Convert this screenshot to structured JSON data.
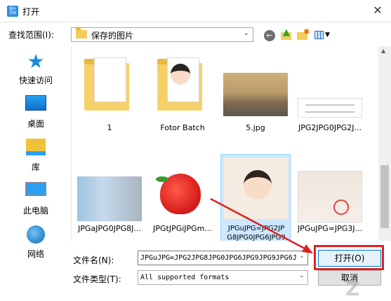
{
  "window": {
    "title": "打开",
    "app_icon_text": "图片 去除",
    "close_glyph": "✕"
  },
  "toolbar": {
    "lookin_label": "查找范围(I):",
    "lookin_value": "保存的图片"
  },
  "places": [
    {
      "label": "快速访问",
      "icon": "star-icon"
    },
    {
      "label": "桌面",
      "icon": "desktop-icon"
    },
    {
      "label": "库",
      "icon": "library-icon"
    },
    {
      "label": "此电脑",
      "icon": "computer-icon"
    },
    {
      "label": "网络",
      "icon": "network-icon"
    }
  ],
  "files": [
    {
      "name": "1",
      "kind": "folder"
    },
    {
      "name": "Fotor Batch",
      "kind": "folder"
    },
    {
      "name": "5.jpg",
      "kind": "image"
    },
    {
      "name": "JPG2JPG0JPG2J...",
      "kind": "document"
    },
    {
      "name": "JPGaJPG0JPG8J...",
      "kind": "image"
    },
    {
      "name": "JPGtJPGiJPGm...",
      "kind": "image"
    },
    {
      "name": "JPGuJPG=JPG2JP",
      "name2": "G8JPG0JPG6JPG9",
      "kind": "image",
      "selected": true
    },
    {
      "name": "JPGuJPG=JPG3J...",
      "kind": "image"
    }
  ],
  "footer": {
    "filename_label": "文件名(N):",
    "filename_value": "JPGuJPG=JPG2JPG8JPG0JPG6JPG9JPG9JPG6J",
    "filetype_label": "文件类型(T):",
    "filetype_value": "All supported formats",
    "open_label": "打开(O)",
    "cancel_label": "取消"
  },
  "colors": {
    "accent": "#0078d7",
    "highlight": "#e02020",
    "selection": "#cce8ff"
  }
}
